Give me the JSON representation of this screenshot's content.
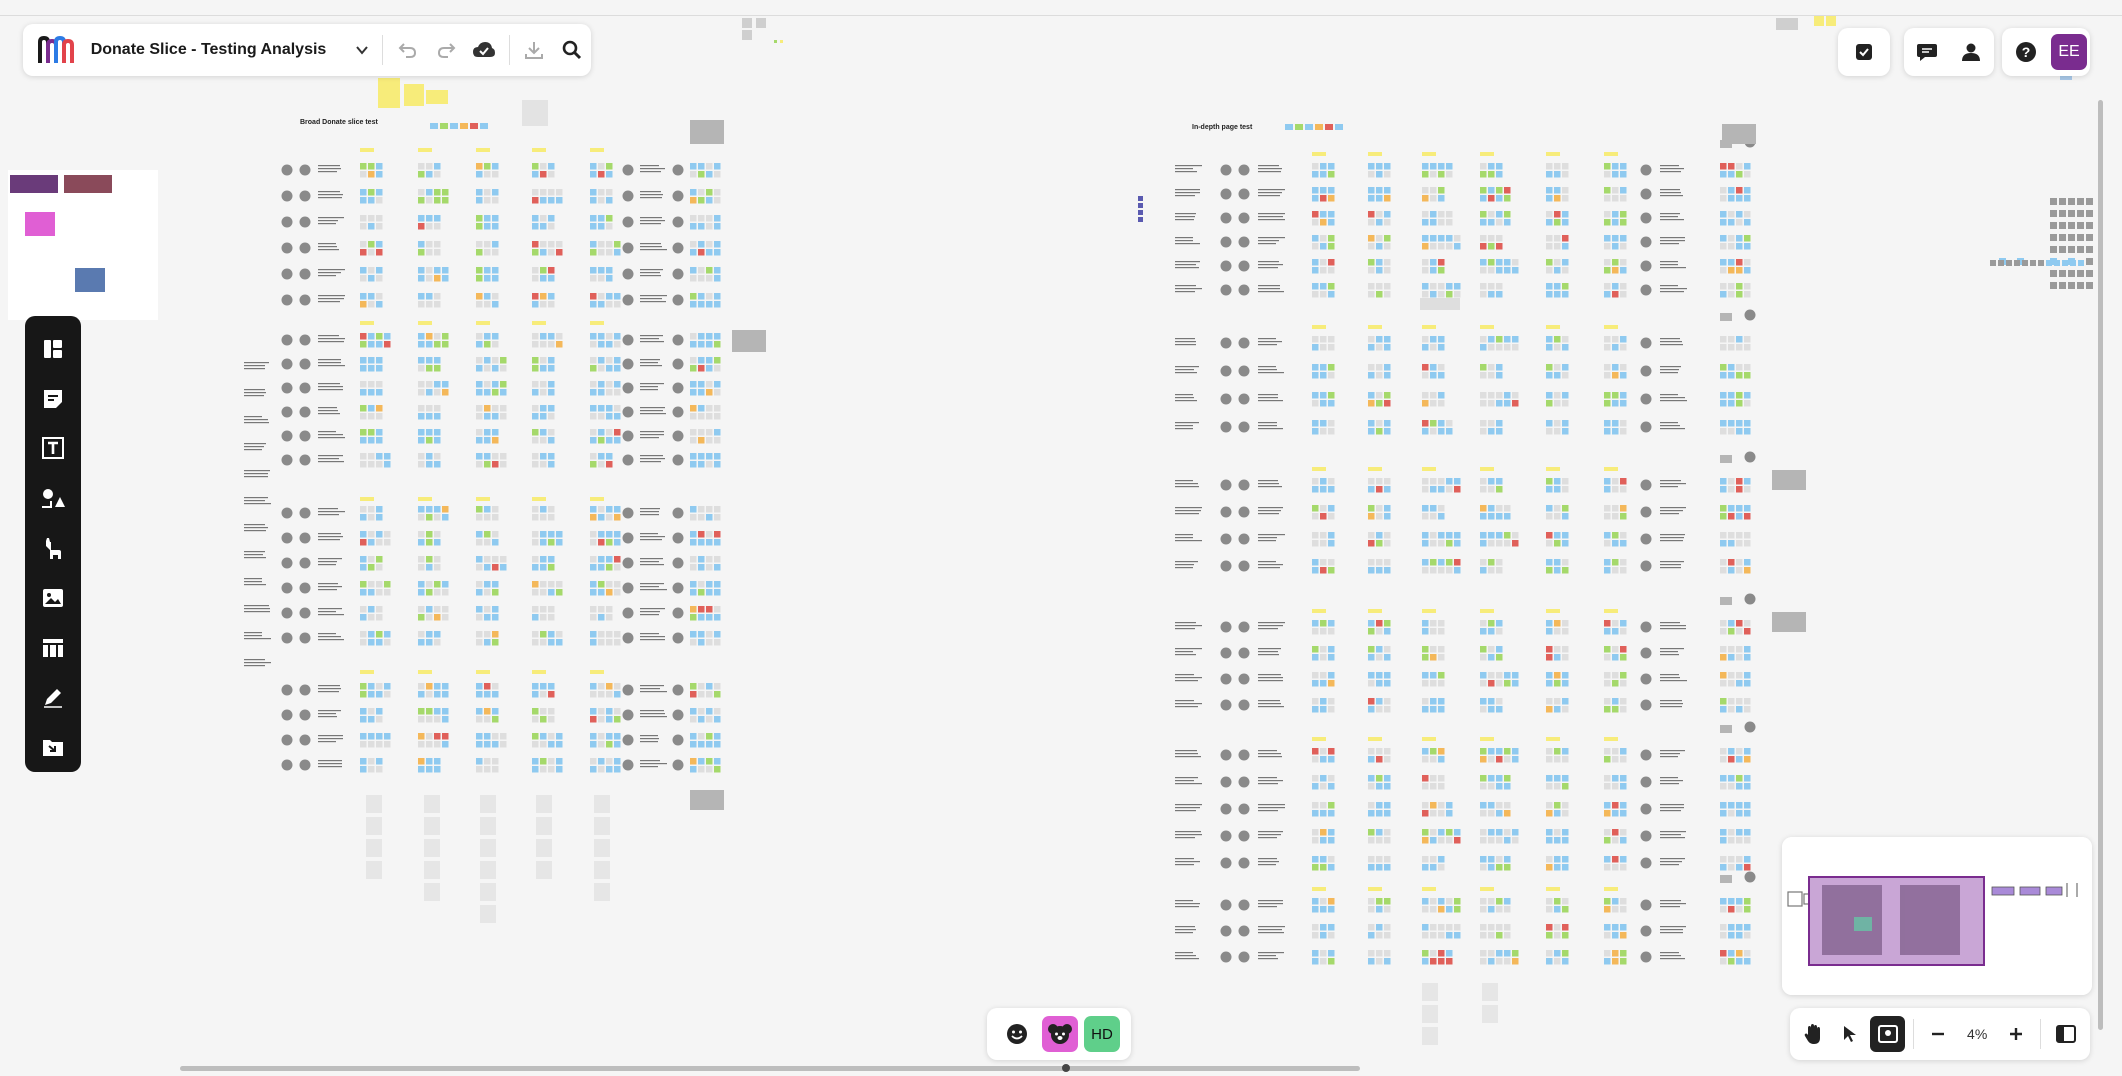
{
  "app": {
    "board_title": "Donate Slice - Testing Analysis",
    "title_dropdown_icon": "chevron-down-icon"
  },
  "header": {
    "undo_icon": "undo-icon",
    "redo_icon": "redo-icon",
    "sync_icon": "cloud-check-icon",
    "export_icon": "download-icon",
    "search_icon": "search-icon"
  },
  "top_right": {
    "tasks_icon": "checkbox-icon",
    "comments_icon": "chat-icon",
    "share_icon": "person-icon",
    "help_label": "?",
    "user_initials": "EE"
  },
  "canvas": {
    "section_left_title": "Broad Donate slice test",
    "section_right_title": "In-depth page test"
  },
  "left_toolbar": {
    "tools": [
      "templates-icon",
      "sticky-note-icon",
      "text-icon",
      "shapes-icon",
      "llama-icon",
      "image-icon",
      "table-icon",
      "pen-icon",
      "import-icon"
    ]
  },
  "collaborators": {
    "emoji_icon": "smiley-icon",
    "avatar_koala": "koala-avatar",
    "avatar_hd": "HD"
  },
  "zoom": {
    "level": "4%",
    "hand_icon": "hand-icon",
    "select_icon": "pointer-icon",
    "minimap_icon": "map-icon",
    "zoom_out_icon": "minus-icon",
    "zoom_in_icon": "plus-icon",
    "panel_icon": "panel-icon"
  },
  "colors": {
    "accent_purple": "#6c2b8e",
    "sticky_blue": "#8fcaf0",
    "sticky_green": "#a5d96b",
    "sticky_red": "#e0605a",
    "sticky_orange": "#f4b85a",
    "sticky_yellow": "#f7ec7a",
    "sticky_gray": "#cfcfcf",
    "hd_avatar": "#5fcf8a",
    "koala_avatar": "#e05fd4",
    "user_avatar": "#7a2c8f"
  }
}
